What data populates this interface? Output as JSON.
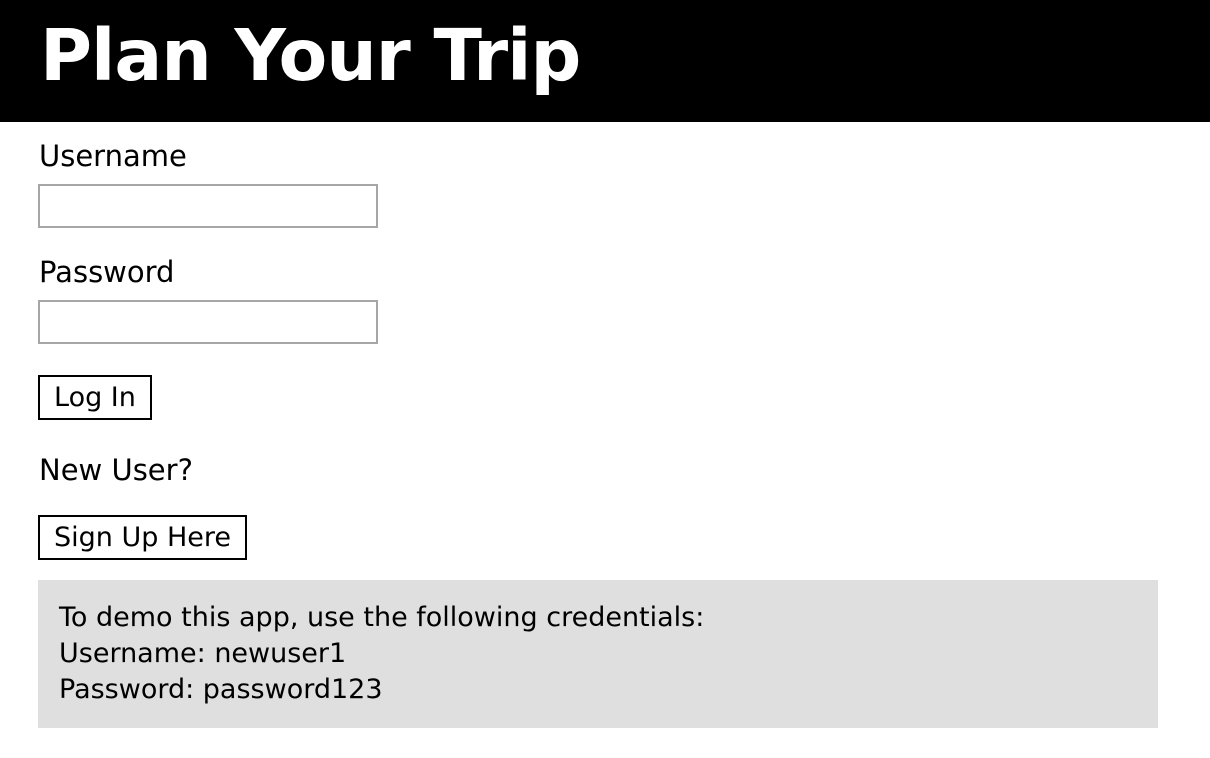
{
  "header": {
    "title": "Plan Your Trip"
  },
  "login_form": {
    "username_label": "Username",
    "username_value": "",
    "password_label": "Password",
    "password_value": "",
    "login_button": "Log In"
  },
  "signup": {
    "prompt": "New User?",
    "button": "Sign Up Here"
  },
  "demo_info": {
    "intro": "To demo this app, use the following credentials:",
    "username_line": "Username: newuser1",
    "password_line": "Password: password123"
  },
  "colors": {
    "header_background": "#000000",
    "header_text": "#ffffff",
    "input_border": "#a6a6a6",
    "demo_box_background": "#dfdfdf"
  }
}
